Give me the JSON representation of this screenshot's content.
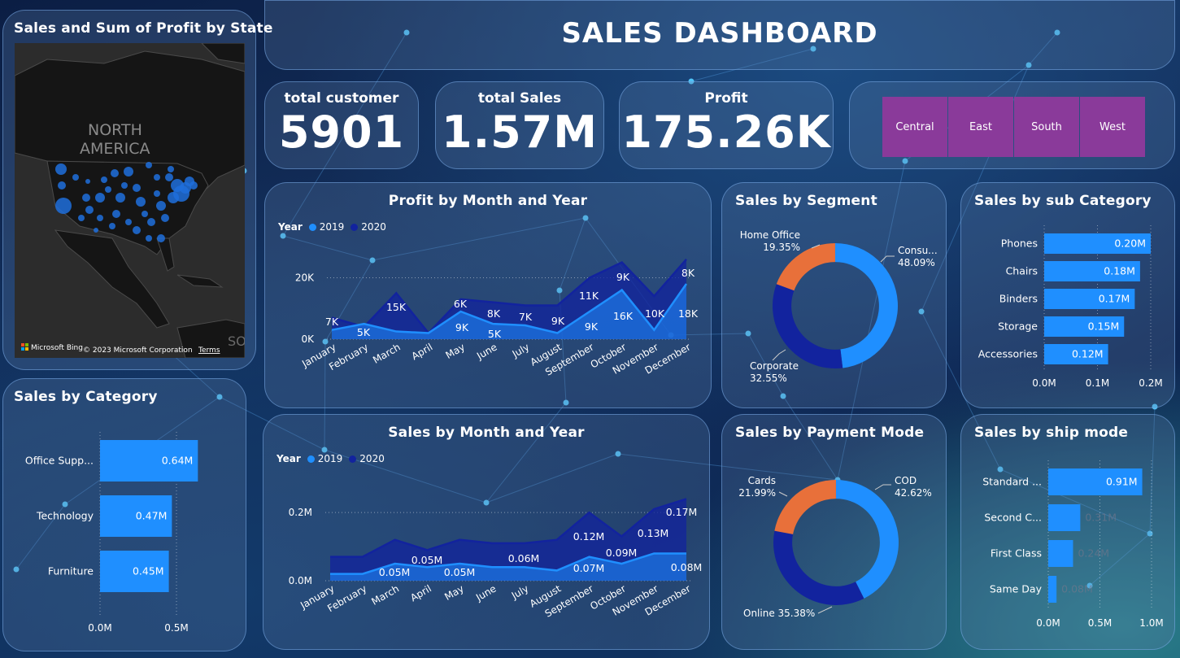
{
  "header": {
    "title": "SALES DASHBOARD"
  },
  "kpis": [
    {
      "label": "total customer",
      "value": "5901"
    },
    {
      "label": "total Sales",
      "value": "1.57M"
    },
    {
      "label": "Profit",
      "value": "175.26K"
    }
  ],
  "regions": [
    "Central",
    "East",
    "South",
    "West"
  ],
  "colors": {
    "y2019": "#1f8fff",
    "y2020": "#12239e",
    "orange": "#e8703a",
    "region": "#8a3a9a"
  },
  "map": {
    "title": "Sales and Sum of Profit by State",
    "labels": [
      "NORTH",
      "AMERICA",
      "SOU"
    ],
    "attribution": "Microsoft Bing",
    "copyright": "© 2023 Microsoft Corporation",
    "terms": "Terms"
  },
  "legend": {
    "title": "Year",
    "s2019": "2019",
    "s2020": "2020"
  },
  "chart_data": [
    {
      "id": "profit_month",
      "type": "area",
      "title": "Profit by Month and Year",
      "categories": [
        "January",
        "February",
        "March",
        "April",
        "May",
        "June",
        "July",
        "August",
        "September",
        "October",
        "November",
        "December"
      ],
      "yticks": [
        "0K",
        "20K"
      ],
      "ylim": [
        0,
        27000
      ],
      "series": [
        {
          "name": "2019",
          "values": [
            3000,
            5000,
            2500,
            2000,
            9000,
            5000,
            4500,
            2000,
            9000,
            16000,
            3000,
            18000
          ]
        },
        {
          "name": "2020",
          "values": [
            7000,
            4000,
            15000,
            2000,
            13000,
            12000,
            11000,
            11000,
            20000,
            25000,
            14000,
            26000
          ]
        }
      ],
      "data_labels": [
        {
          "month": "January",
          "text": "7K"
        },
        {
          "month": "February",
          "text": "5K"
        },
        {
          "month": "March",
          "text": "15K"
        },
        {
          "month": "May",
          "text": "6K"
        },
        {
          "month": "May",
          "text": "9K"
        },
        {
          "month": "June",
          "text": "8K"
        },
        {
          "month": "June",
          "text": "5K"
        },
        {
          "month": "July",
          "text": "7K"
        },
        {
          "month": "August",
          "text": "9K"
        },
        {
          "month": "September",
          "text": "11K"
        },
        {
          "month": "September",
          "text": "9K"
        },
        {
          "month": "October",
          "text": "9K"
        },
        {
          "month": "October",
          "text": "16K"
        },
        {
          "month": "November",
          "text": "10K"
        },
        {
          "month": "December",
          "text": "8K"
        },
        {
          "month": "December",
          "text": "18K"
        }
      ]
    },
    {
      "id": "sales_month",
      "type": "area",
      "title": "Sales by Month and Year",
      "categories": [
        "January",
        "February",
        "March",
        "April",
        "May",
        "June",
        "July",
        "August",
        "September",
        "October",
        "November",
        "December"
      ],
      "yticks": [
        "0.0M",
        "0.2M"
      ],
      "ylim": [
        0,
        0.26
      ],
      "series": [
        {
          "name": "2019",
          "values": [
            0.02,
            0.02,
            0.05,
            0.04,
            0.05,
            0.04,
            0.04,
            0.03,
            0.07,
            0.05,
            0.08,
            0.08
          ]
        },
        {
          "name": "2020",
          "values": [
            0.07,
            0.07,
            0.12,
            0.09,
            0.12,
            0.11,
            0.11,
            0.12,
            0.2,
            0.13,
            0.21,
            0.24
          ]
        }
      ],
      "data_labels": [
        {
          "month": "April",
          "text": "0.05M"
        },
        {
          "month": "March",
          "text": "0.05M"
        },
        {
          "month": "May",
          "text": "0.05M"
        },
        {
          "month": "July",
          "text": "0.06M"
        },
        {
          "month": "September",
          "text": "0.12M"
        },
        {
          "month": "September",
          "text": "0.07M"
        },
        {
          "month": "October",
          "text": "0.09M"
        },
        {
          "month": "November",
          "text": "0.13M"
        },
        {
          "month": "December",
          "text": "0.17M"
        },
        {
          "month": "December",
          "text": "0.08M"
        }
      ]
    },
    {
      "id": "category",
      "type": "bar",
      "title": "Sales by Category",
      "categories": [
        "Office Supp...",
        "Technology",
        "Furniture"
      ],
      "values": [
        0.64,
        0.47,
        0.45
      ],
      "labels": [
        "0.64M",
        "0.47M",
        "0.45M"
      ],
      "xticks": [
        "0.0M",
        "0.5M"
      ],
      "xlim": [
        0,
        0.5
      ]
    },
    {
      "id": "subcategory",
      "type": "bar",
      "title": "Sales by sub Category",
      "categories": [
        "Phones",
        "Chairs",
        "Binders",
        "Storage",
        "Accessories"
      ],
      "values": [
        0.2,
        0.18,
        0.17,
        0.15,
        0.12
      ],
      "labels": [
        "0.20M",
        "0.18M",
        "0.17M",
        "0.15M",
        "0.12M"
      ],
      "xticks": [
        "0.0M",
        "0.1M",
        "0.2M"
      ],
      "xlim": [
        0,
        0.2
      ]
    },
    {
      "id": "shipmode",
      "type": "bar",
      "title": "Sales by ship mode",
      "categories": [
        "Standard ...",
        "Second C...",
        "First Class",
        "Same Day"
      ],
      "values": [
        0.91,
        0.31,
        0.24,
        0.08
      ],
      "labels": [
        "0.91M",
        "0.31M",
        "0.24M",
        "0.08M"
      ],
      "xticks": [
        "0.0M",
        "0.5M",
        "1.0M"
      ],
      "xlim": [
        0,
        1.0
      ]
    },
    {
      "id": "segment",
      "type": "pie",
      "title": "Sales by Segment",
      "slices": [
        {
          "name": "Consu...",
          "pct": 48.09,
          "label": "48.09%",
          "color": "#1f8fff"
        },
        {
          "name": "Corporate",
          "pct": 32.55,
          "label": "32.55%",
          "color": "#12239e"
        },
        {
          "name": "Home Office",
          "pct": 19.35,
          "label": "19.35%",
          "color": "#e8703a"
        }
      ]
    },
    {
      "id": "payment",
      "type": "pie",
      "title": "Sales by Payment Mode",
      "slices": [
        {
          "name": "COD",
          "pct": 42.62,
          "label": "42.62%",
          "color": "#1f8fff"
        },
        {
          "name": "Online",
          "pct": 35.38,
          "label": "35.38%",
          "color": "#12239e"
        },
        {
          "name": "Cards",
          "pct": 21.99,
          "label": "21.99%",
          "color": "#e8703a"
        }
      ]
    }
  ]
}
